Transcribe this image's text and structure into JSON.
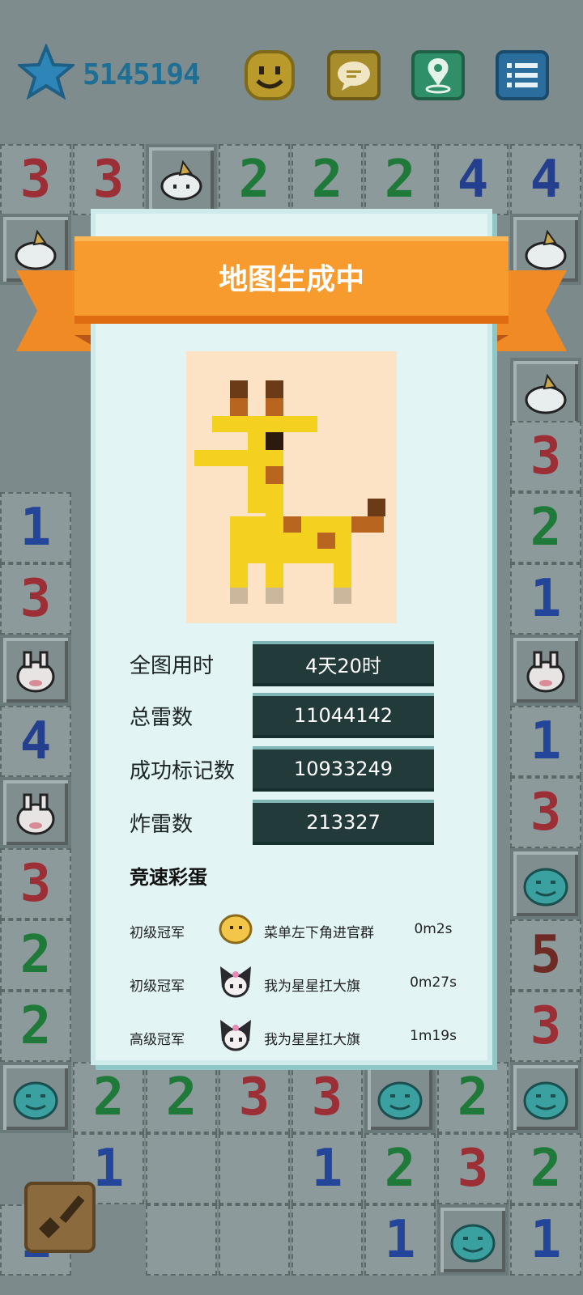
{
  "header": {
    "score": "5145194",
    "icons": [
      "star-icon",
      "smiley-face-icon",
      "chat-icon",
      "map-location-icon",
      "menu-list-icon"
    ]
  },
  "board": {
    "numbers": [
      {
        "v": "3",
        "c": "n3"
      },
      {
        "v": "3",
        "c": "n3"
      },
      {
        "v": "",
        "c": ""
      },
      {
        "v": "2",
        "c": "n2"
      },
      {
        "v": "2",
        "c": "n2"
      },
      {
        "v": "2",
        "c": "n2"
      },
      {
        "v": "4",
        "c": "n4"
      },
      {
        "v": "4",
        "c": "n4"
      }
    ],
    "left_col": [
      {
        "v": "1",
        "c": "n1"
      },
      {
        "v": "3",
        "c": "n3"
      },
      {
        "v": "4",
        "c": "n4"
      },
      {
        "v": "3",
        "c": "n3"
      },
      {
        "v": "2",
        "c": "n2"
      },
      {
        "v": "2",
        "c": "n2"
      }
    ],
    "right_col": [
      {
        "v": "3",
        "c": "n3"
      },
      {
        "v": "2",
        "c": "n2"
      },
      {
        "v": "1",
        "c": "n1"
      },
      {
        "v": "1",
        "c": "n1"
      },
      {
        "v": "3",
        "c": "n3"
      },
      {
        "v": "5",
        "c": "n5"
      },
      {
        "v": "3",
        "c": "n3"
      }
    ],
    "bottom_row1": [
      {
        "v": "2",
        "c": "n2"
      },
      {
        "v": "2",
        "c": "n2"
      },
      {
        "v": "3",
        "c": "n3"
      },
      {
        "v": "3",
        "c": "n3"
      },
      {
        "v": "2",
        "c": "n2"
      }
    ],
    "bottom_row2": [
      {
        "v": "1",
        "c": "n1"
      },
      {
        "v": "1",
        "c": "n1"
      },
      {
        "v": "2",
        "c": "n2"
      },
      {
        "v": "3",
        "c": "n3"
      },
      {
        "v": "2",
        "c": "n2"
      }
    ],
    "bottom_row3": [
      {
        "v": "1",
        "c": "n1"
      },
      {
        "v": "1",
        "c": "n1"
      },
      {
        "v": "1",
        "c": "n1"
      }
    ]
  },
  "dialog": {
    "title": "地图生成中",
    "stats": [
      {
        "label": "全图用时",
        "value": "4天20时"
      },
      {
        "label": "总雷数",
        "value": "11044142"
      },
      {
        "label": "成功标记数",
        "value": "10933249"
      },
      {
        "label": "炸雷数",
        "value": "213327"
      }
    ],
    "section_title": "竞速彩蛋",
    "records": [
      {
        "rank": "初级冠军",
        "avatar": "chick-avatar-icon",
        "name": "菜单左下角进官群",
        "time": "0m2s"
      },
      {
        "rank": "初级冠军",
        "avatar": "kuromi-avatar-icon",
        "name": "我为星星扛大旗",
        "time": "0m27s"
      },
      {
        "rank": "高级冠军",
        "avatar": "kuromi-avatar-icon",
        "name": "我为星星扛大旗",
        "time": "1m19s"
      }
    ]
  },
  "colors": {
    "ribbon": "#f79b2f",
    "card": "#e2f4f4",
    "stat_box": "#233a3a",
    "score": "#1f6f95"
  }
}
